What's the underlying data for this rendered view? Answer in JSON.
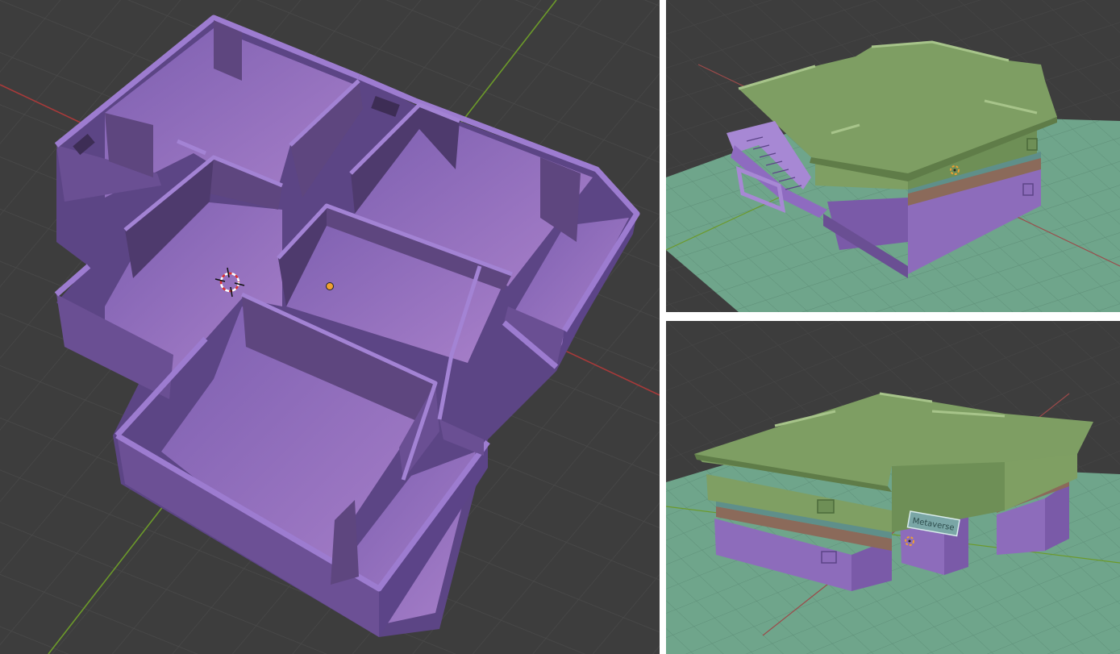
{
  "panels": {
    "main": {
      "view": "floor-plan-perspective",
      "shading": "solid"
    },
    "top_right": {
      "view": "building-rear-perspective",
      "shading": "solid"
    },
    "bottom_right": {
      "view": "building-front-perspective",
      "shading": "solid"
    }
  },
  "sign": {
    "text": "Metaverse"
  },
  "colors": {
    "viewport_bg": "#3d3d3d",
    "grid_line": "#4a4a4a",
    "x_axis": "#b03a3a",
    "y_axis": "#6c9a2a",
    "wall_purple": "#7a5aa8",
    "floor_purple": "#8e6bc0",
    "roof_green": "#6e8f56",
    "ground_teal": "#6fa58b",
    "orange_origin": "#f0a030"
  },
  "icons": [
    "3d-cursor-icon",
    "origin-point-icon"
  ]
}
